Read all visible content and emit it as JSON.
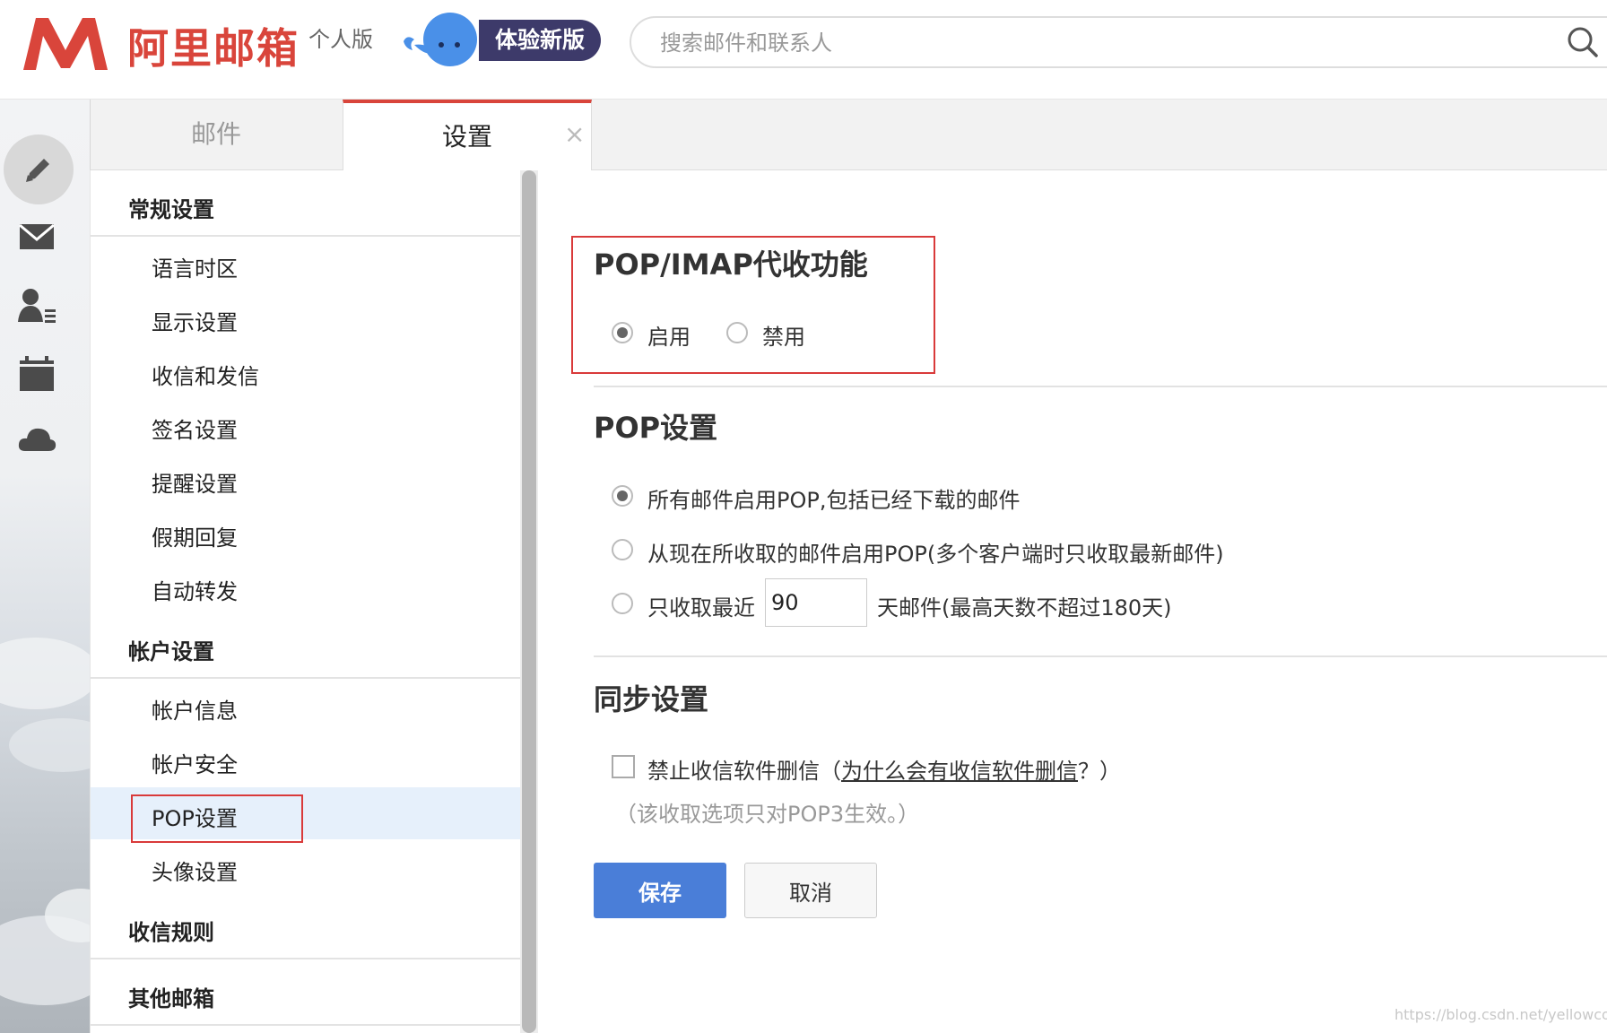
{
  "header": {
    "brand": "阿里邮箱",
    "edition": "个人版",
    "try_new": "体验新版",
    "search_placeholder": "搜索邮件和联系人",
    "brand_color": "#d9453b"
  },
  "rail": {
    "icons": [
      "pencil-icon",
      "mail-icon",
      "contacts-icon",
      "calendar-icon",
      "cloud-icon"
    ]
  },
  "tabs": {
    "mail": "邮件",
    "settings": "设置",
    "close": "×"
  },
  "nav": {
    "general": {
      "title": "常规设置",
      "items": [
        "语言时区",
        "显示设置",
        "收信和发信",
        "签名设置",
        "提醒设置",
        "假期回复",
        "自动转发"
      ]
    },
    "account": {
      "title": "帐户设置",
      "items": [
        "帐户信息",
        "帐户安全",
        "POP设置",
        "头像设置"
      ],
      "active": "POP设置"
    },
    "rules": {
      "title": "收信规则"
    },
    "other": {
      "title": "其他邮箱"
    }
  },
  "main": {
    "pop_imap": {
      "title": "POP/IMAP代收功能",
      "enable": "启用",
      "disable": "禁用",
      "selected": "启用"
    },
    "pop_settings": {
      "title": "POP设置",
      "option_all": "所有邮件启用POP,包括已经下载的邮件",
      "option_from_now": "从现在所收取的邮件启用POP(多个客户端时只收取最新邮件)",
      "option_recent_prefix": "只收取最近",
      "option_recent_days": "90",
      "option_recent_suffix": "天邮件(最高天数不超过180天)",
      "selected": "option_all"
    },
    "sync": {
      "title": "同步设置",
      "checkbox_label": "禁止收信软件删信",
      "paren_open": "（",
      "link": "为什么会有收信软件删信",
      "paren_close": "？）",
      "hint": "（该收取选项只对POP3生效。）",
      "checked": false
    },
    "buttons": {
      "save": "保存",
      "cancel": "取消"
    }
  },
  "colors": {
    "accent": "#4a7ed8",
    "highlight_red": "#d93a3a",
    "active_row": "#e6f0fb"
  },
  "watermark": "https://blog.csdn.net/yellowcong"
}
